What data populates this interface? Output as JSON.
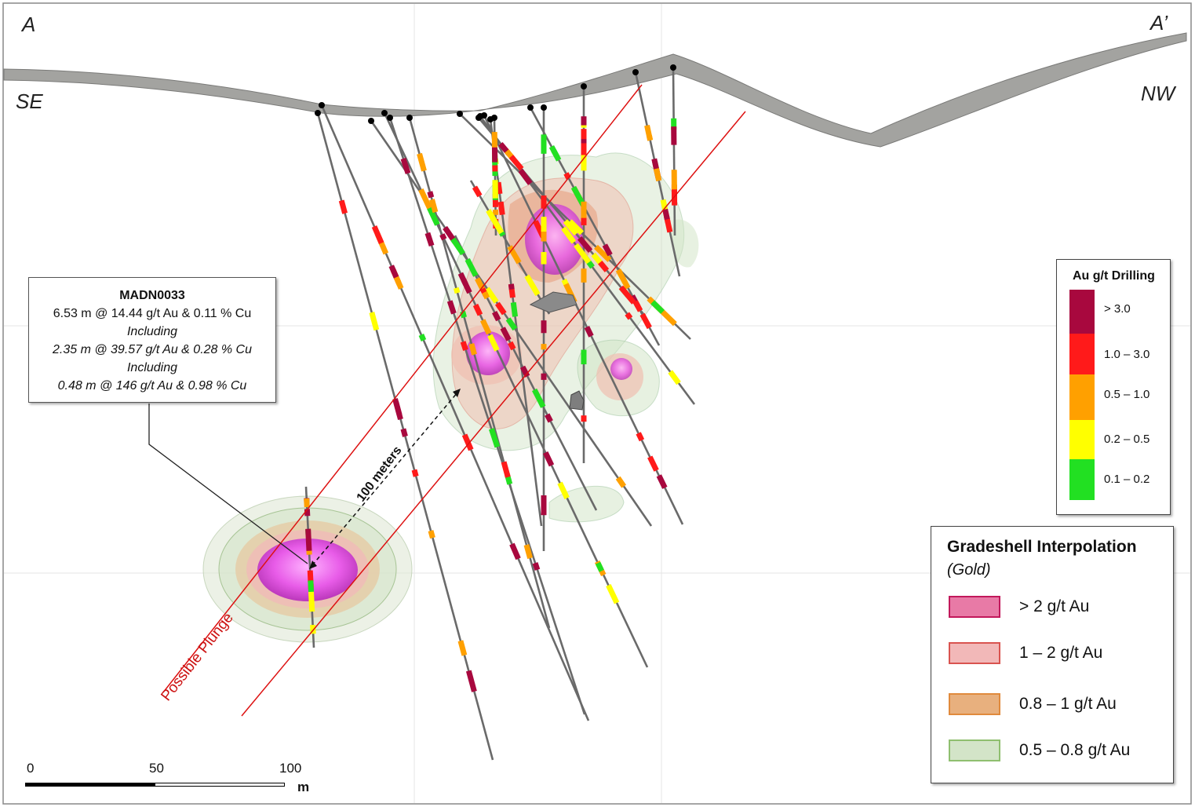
{
  "section": {
    "corner_left": "A",
    "corner_right": "A’",
    "dir_left": "SE",
    "dir_right": "NW",
    "plunge_label": "Possible Plunge",
    "distance_label": "100 meters"
  },
  "callout": {
    "hole_id": "MADN0033",
    "line1": "6.53 m @ 14.44 g/t Au & 0.11 % Cu",
    "line2": "Including",
    "line3": "2.35 m @ 39.57 g/t Au & 0.28 % Cu",
    "line4": "Including",
    "line5": "0.48 m @ 146 g/t Au & 0.98 % Cu"
  },
  "drill_legend": {
    "title": "Au g/t Drilling",
    "items": [
      {
        "label": "> 3.0",
        "color": "#a8083e"
      },
      {
        "label": "1.0 – 3.0",
        "color": "#ff1a1a"
      },
      {
        "label": "0.5 – 1.0",
        "color": "#ffa000"
      },
      {
        "label": "0.2 – 0.5",
        "color": "#ffff00"
      },
      {
        "label": "0.1 – 0.2",
        "color": "#22e022"
      }
    ]
  },
  "shell_legend": {
    "title": "Gradeshell Interpolation",
    "subtitle": "(Gold)",
    "items": [
      {
        "label": "> 2 g/t Au",
        "fill": "#e87aa6",
        "stroke": "#c2185b"
      },
      {
        "label": "1 – 2 g/t Au",
        "fill": "#f2b8b8",
        "stroke": "#d9534f"
      },
      {
        "label": "0.8 – 1 g/t Au",
        "fill": "#e8b07e",
        "stroke": "#e08a3c"
      },
      {
        "label": "0.5 – 0.8 g/t Au",
        "fill": "#d3e4c8",
        "stroke": "#8fbf6f"
      }
    ]
  },
  "scalebar": {
    "ticks": [
      "0",
      "50",
      "100"
    ],
    "unit": "m"
  },
  "colors": {
    "surface": "#a3a3a0",
    "drill_trace": "#6a6a6a",
    "plunge_line": "#dd1111",
    "shell_core": "#e060e0"
  }
}
